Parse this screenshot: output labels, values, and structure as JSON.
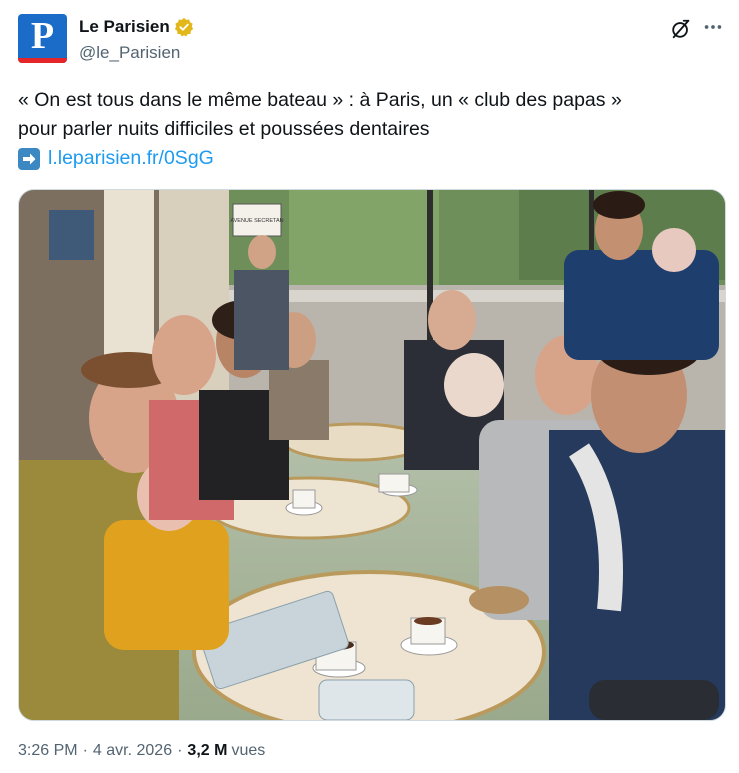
{
  "account": {
    "avatar_letter": "P",
    "display_name": "Le Parisien",
    "handle": "@le_Parisien",
    "verified_color": "#e2b719"
  },
  "tweet": {
    "line1": "« On est tous dans le même bateau » : à Paris, un « club des papas »",
    "line2": "pour parler nuits difficiles et poussées dentaires",
    "link_text": "l.leparisien.fr/0SgG"
  },
  "photo": {
    "street_sign": "AVENUE SECRETAN"
  },
  "meta": {
    "time": "3:26 PM",
    "date": "4 avr. 2026",
    "views_count": "3,2 M",
    "views_label": "vues"
  },
  "colors": {
    "brand_blue": "#1a6cc8",
    "link_blue": "#1d9bf0",
    "secondary_text": "#536471"
  }
}
